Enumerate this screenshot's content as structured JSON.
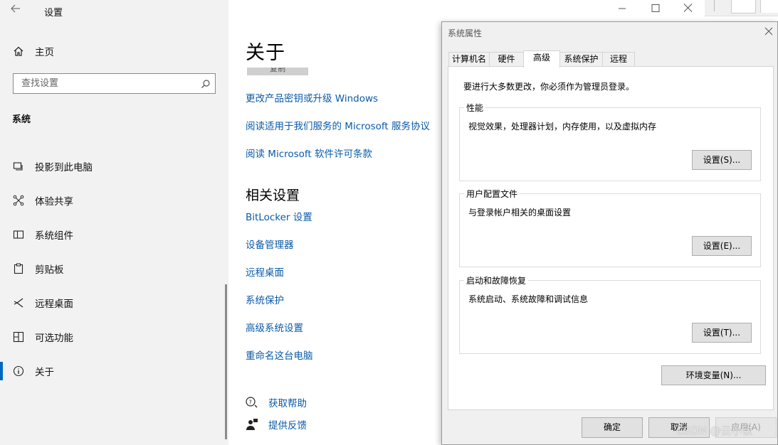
{
  "nav": {
    "app_title": "设置",
    "home": "主页",
    "search_placeholder": "查找设置",
    "section": "系统",
    "items": [
      {
        "label": "投影到此电脑",
        "icon": "projector-icon"
      },
      {
        "label": "体验共享",
        "icon": "share-experience-icon"
      },
      {
        "label": "系统组件",
        "icon": "components-icon"
      },
      {
        "label": "剪贴板",
        "icon": "clipboard-icon"
      },
      {
        "label": "远程桌面",
        "icon": "remote-desktop-icon"
      },
      {
        "label": "可选功能",
        "icon": "optional-features-icon"
      },
      {
        "label": "关于",
        "icon": "info-icon",
        "active": true
      }
    ]
  },
  "content": {
    "title": "关于",
    "rename_button": "复制",
    "links": [
      "更改产品密钥或升级 Windows",
      "阅读适用于我们服务的 Microsoft 服务协议",
      "阅读 Microsoft 软件许可条款"
    ],
    "related_title": "相关设置",
    "related_links": [
      "BitLocker 设置",
      "设备管理器",
      "远程桌面",
      "系统保护",
      "高级系统设置",
      "重命名这台电脑"
    ],
    "get_help": "获取帮助",
    "feedback": "提供反馈"
  },
  "dialog": {
    "title": "系统属性",
    "tabs": [
      "计算机名",
      "硬件",
      "高级",
      "系统保护",
      "远程"
    ],
    "active_tab": "高级",
    "admin_note": "要进行大多数更改，你必须作为管理员登录。",
    "performance": {
      "title": "性能",
      "desc": "视觉效果，处理器计划，内存使用，以及虚拟内存",
      "button": "设置(S)..."
    },
    "user_profiles": {
      "title": "用户配置文件",
      "desc": "与登录帐户相关的桌面设置",
      "button": "设置(E)..."
    },
    "startup": {
      "title": "启动和故障恢复",
      "desc": "系统启动、系统故障和调试信息",
      "button": "设置(T)..."
    },
    "env_button": "环境变量(N)...",
    "ok": "确定",
    "cancel": "取消",
    "apply": "应用(A)"
  },
  "watermark": "CSDN @云小钦",
  "colors": {
    "accent": "#0067c0",
    "link": "#0a5aa8",
    "nav_bg": "#f2f2f2",
    "dialog_bg": "#f0f0f0"
  }
}
